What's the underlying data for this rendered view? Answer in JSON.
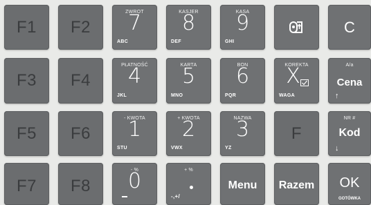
{
  "function_keys": {
    "f1": "F1",
    "f2": "F2",
    "f3": "F3",
    "f4": "F4",
    "f5": "F5",
    "f6": "F6",
    "f7": "F7",
    "f8": "F8",
    "f": "F",
    "c": "C"
  },
  "k7": {
    "top": "ZWROT",
    "digit": "7",
    "letters": "ABC"
  },
  "k8": {
    "top": "KASJER",
    "digit": "8",
    "letters": "DEF"
  },
  "k9": {
    "top": "KASA",
    "digit": "9",
    "letters": "GHI"
  },
  "k4": {
    "top": "PŁATNOŚĆ",
    "digit": "4",
    "letters": "JKL"
  },
  "k5": {
    "top": "KARTA",
    "digit": "5",
    "letters": "MNO"
  },
  "k6": {
    "top": "BON",
    "digit": "6",
    "letters": "PQR"
  },
  "k1": {
    "top": "- KWOTA",
    "digit": "1",
    "letters": "STU"
  },
  "k2": {
    "top": "+ KWOTA",
    "digit": "2",
    "letters": "VWX"
  },
  "k3": {
    "top": "NAZWA",
    "digit": "3",
    "letters": "YZ"
  },
  "k0": {
    "top": "- %",
    "digit": "0"
  },
  "kdot": {
    "top": "+ %",
    "sub": "-,+/"
  },
  "korekta": {
    "top": "KOREKTA",
    "symbol": "X",
    "sub": "WAGA"
  },
  "cena": {
    "top": "A/a",
    "label": "Cena",
    "arrow": "↑"
  },
  "kod": {
    "top": "NR #",
    "label": "Kod",
    "arrow": "↓"
  },
  "menu": {
    "label": "Menu"
  },
  "razem": {
    "label": "Razem"
  },
  "ok": {
    "label": "OK",
    "sub": "GOTÓWKA"
  }
}
